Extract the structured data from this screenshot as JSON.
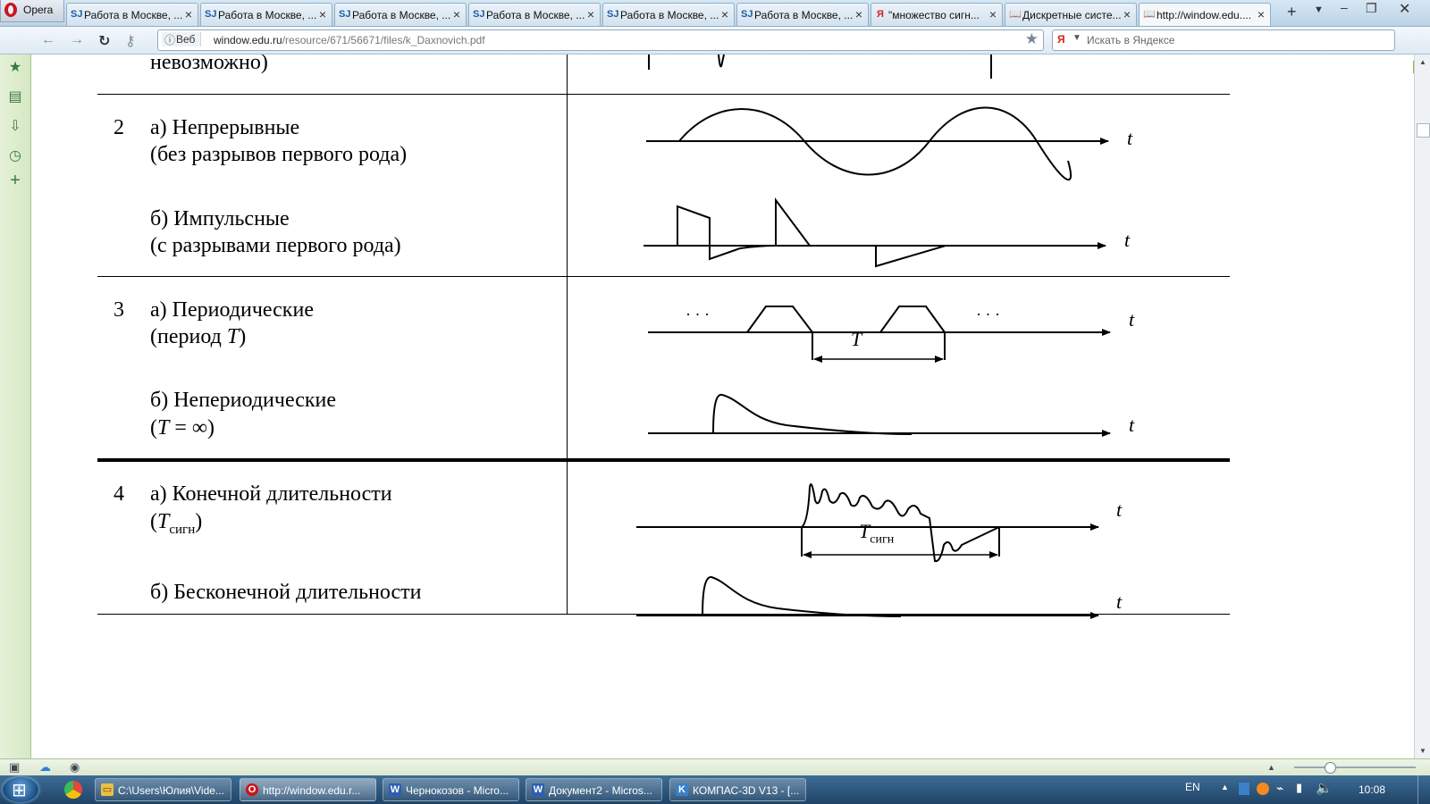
{
  "browser": {
    "menu_label": "Opera",
    "tabs": [
      {
        "label": "Работа в Москве, ...",
        "favicon": "SJ"
      },
      {
        "label": "Работа в Москве, ...",
        "favicon": "SJ"
      },
      {
        "label": "Работа в Москве, ...",
        "favicon": "SJ"
      },
      {
        "label": "Работа в Москве, ...",
        "favicon": "SJ"
      },
      {
        "label": "Работа в Москве, ...",
        "favicon": "SJ"
      },
      {
        "label": "Работа в Москве, ...",
        "favicon": "SJ"
      },
      {
        "label": "\"множество сигн...",
        "favicon": "Я"
      },
      {
        "label": "Дискретные систе...",
        "favicon": "📖"
      },
      {
        "label": "http://window.edu....",
        "favicon": "📖"
      }
    ],
    "active_tab": 8,
    "address": {
      "mode_label": "Веб",
      "url_host": "window.edu.ru",
      "url_path": "/resource/671/56671/files/k_Daxnovich.pdf"
    },
    "search": {
      "engine_letter": "Я",
      "placeholder": "Искать в Яндексе"
    }
  },
  "document": {
    "row1_tail": "невозможно)",
    "rows": [
      {
        "num": "2",
        "a_line1": "а)  Непрерывные",
        "a_line2": "(без разрывов первого рода)",
        "b_line1": "б)  Импульсные",
        "b_line2": "(с разрывами первого рода)"
      },
      {
        "num": "3",
        "a_line1": "а)  Периодические",
        "a_line2_prefix": "(период ",
        "a_line2_var": "T",
        "a_line2_suffix": ")",
        "b_line1": "б)  Непериодические",
        "b_line2_prefix": "(",
        "b_line2_var": "T",
        "b_line2_suffix": " = ∞)"
      },
      {
        "num": "4",
        "a_line1": "а)  Конечной длительности",
        "a_line2_var": "T",
        "a_line2_sub": "сигн",
        "b_line1": "б)  Бесконечной длительности"
      }
    ],
    "axis_label": "t",
    "period_label": "T",
    "duration_label": "T",
    "duration_sub": "сигн",
    "ellipsis": "· · ·"
  },
  "taskbar": {
    "tasks": [
      {
        "label": "C:\\Users\\Юлия\\Vide...",
        "icon": "folder-icon",
        "color": "#e8c046"
      },
      {
        "label": "http://window.edu.r...",
        "icon": "opera-icon",
        "color": "#c9141b"
      },
      {
        "label": "Чернокозов - Micro...",
        "icon": "word-icon",
        "color": "#2b5fb4"
      },
      {
        "label": "Документ2 - Micros...",
        "icon": "word-icon",
        "color": "#2b5fb4"
      },
      {
        "label": "КОМПАС-3D V13 - [...",
        "icon": "kompas-icon",
        "color": "#3b7fc8"
      }
    ],
    "lang": "EN",
    "time": "10:08"
  }
}
